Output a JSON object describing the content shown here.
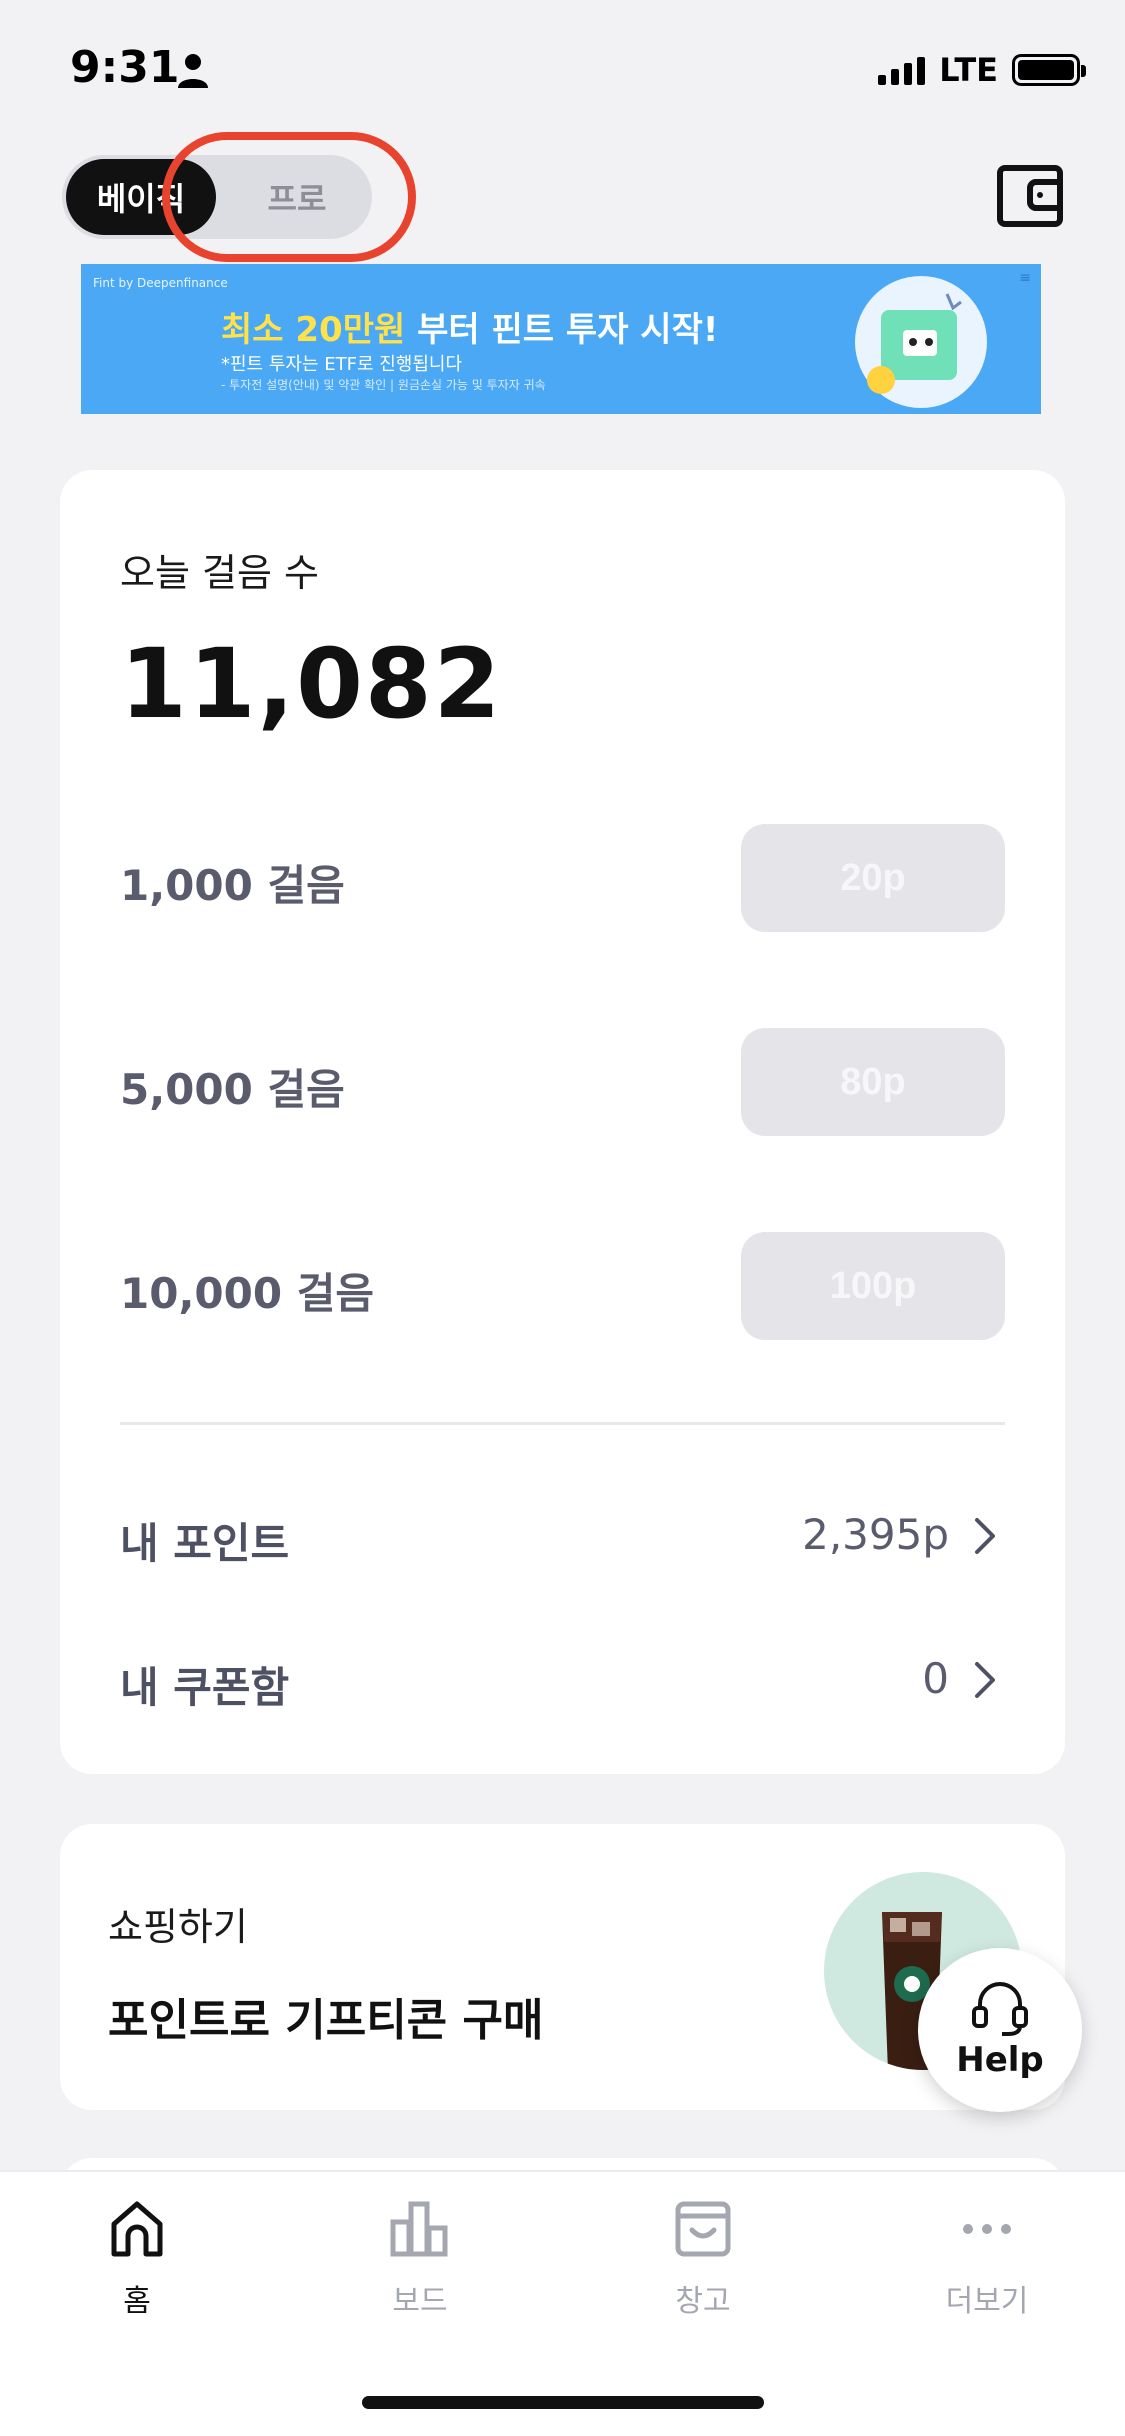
{
  "status_bar": {
    "time": "9:31",
    "network": "LTE",
    "icons": [
      "person-icon",
      "signal-icon",
      "battery-icon"
    ]
  },
  "header": {
    "toggle": {
      "basic_label": "베이직",
      "pro_label": "프로",
      "selected": "basic"
    },
    "wallet_icon": "wallet-icon"
  },
  "banner": {
    "brand": "Fint by Deepenfinance",
    "headline_highlight": "최소 20만원",
    "headline_rest": " 부터 핀트 투자 시작!",
    "subline": "*핀트 투자는 ETF로 진행됩니다",
    "note": "- 투자전 설명(안내) 및 약관 확인 | 원금손실 가능 및 투자자 귀속"
  },
  "steps_card": {
    "label": "오늘 걸음 수",
    "count": "11,082",
    "rewards": [
      {
        "label": "1,000 걸음",
        "points": "20p"
      },
      {
        "label": "5,000 걸음",
        "points": "80p"
      },
      {
        "label": "10,000 걸음",
        "points": "100p"
      }
    ],
    "my_points": {
      "label": "내 포인트",
      "value": "2,395p"
    },
    "my_coupons": {
      "label": "내 쿠폰함",
      "value": "0"
    }
  },
  "shop_card": {
    "label": "쇼핑하기",
    "title": "포인트로 기프티콘 구매"
  },
  "help": {
    "label": "Help"
  },
  "tab_bar": {
    "tabs": [
      {
        "label": "홈",
        "icon": "home-icon",
        "active": true
      },
      {
        "label": "보드",
        "icon": "chart-icon",
        "active": false
      },
      {
        "label": "창고",
        "icon": "storage-icon",
        "active": false
      },
      {
        "label": "더보기",
        "icon": "more-icon",
        "active": false
      }
    ]
  },
  "colors": {
    "background": "#f2f2f5",
    "banner_blue": "#4aa8f5",
    "annotation_red": "#e8432e",
    "reward_button": "#e4e4e9"
  }
}
